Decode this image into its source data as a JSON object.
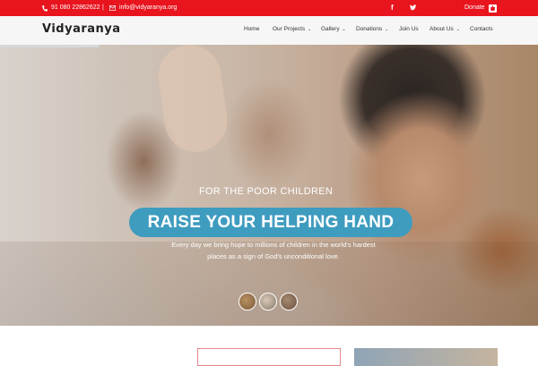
{
  "topbar": {
    "phone": "91 080 22862622",
    "separator": "|",
    "email": "info@vidyaranya.org",
    "facebook_glyph": "f",
    "donate_label": "Donate",
    "bg_color": "#e8141e"
  },
  "navbar": {
    "logo": "Vidyaranya",
    "items": [
      {
        "label": "Home",
        "chevron": ""
      },
      {
        "label": "Our Projects",
        "chevron": "⌄"
      },
      {
        "label": "Gallery",
        "chevron": "⌄"
      },
      {
        "label": "Donations",
        "chevron": "⌄"
      },
      {
        "label": "Join Us",
        "chevron": ""
      },
      {
        "label": "About Us",
        "chevron": "⌄"
      },
      {
        "label": "Contacts",
        "chevron": ""
      }
    ]
  },
  "hero": {
    "subtitle": "FOR THE POOR CHILDREN",
    "title": "RAISE YOUR HELPING HAND",
    "text": "Every day we bring hope to millions of children in the world's hardest places as a sign of God's unconditional love.",
    "accent_color": "#3e9cbf"
  },
  "icons": {
    "phone": "phone-icon",
    "email": "email-icon",
    "facebook": "facebook-icon",
    "twitter": "twitter-icon",
    "donate": "donate-icon"
  }
}
